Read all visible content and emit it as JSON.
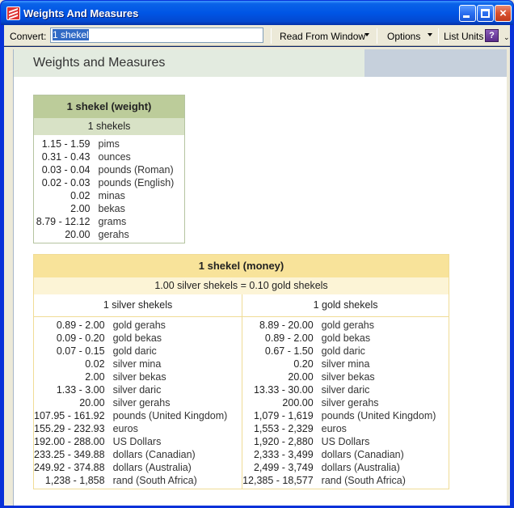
{
  "window": {
    "title": "Weights And Measures"
  },
  "toolbar": {
    "convert_label": "Convert:",
    "convert_value": "1 shekel",
    "read_from_window": "Read From Window",
    "options": "Options",
    "list_units": "List Units",
    "help_glyph": "?"
  },
  "page": {
    "title": "Weights and Measures"
  },
  "weight": {
    "heading": "1 shekel (weight)",
    "subheading": "1 shekels",
    "rows": [
      {
        "value": "1.15 - 1.59",
        "unit": "pims"
      },
      {
        "value": "0.31 - 0.43",
        "unit": "ounces"
      },
      {
        "value": "0.03 - 0.04",
        "unit": "pounds (Roman)"
      },
      {
        "value": "0.02 - 0.03",
        "unit": "pounds (English)"
      },
      {
        "value": "0.02",
        "unit": "minas"
      },
      {
        "value": "2.00",
        "unit": "bekas"
      },
      {
        "value": "8.79 - 12.12",
        "unit": "grams"
      },
      {
        "value": "20.00",
        "unit": "gerahs"
      }
    ]
  },
  "money": {
    "heading": "1 shekel (money)",
    "subheading": "1.00 silver shekels = 0.10 gold shekels",
    "left_header": "1 silver shekels",
    "right_header": "1 gold shekels",
    "rows": [
      {
        "l_value": "0.89 - 2.00",
        "l_unit": "gold gerahs",
        "r_value": "8.89 - 20.00",
        "r_unit": "gold gerahs"
      },
      {
        "l_value": "0.09 - 0.20",
        "l_unit": "gold bekas",
        "r_value": "0.89 - 2.00",
        "r_unit": "gold bekas"
      },
      {
        "l_value": "0.07 - 0.15",
        "l_unit": "gold daric",
        "r_value": "0.67 - 1.50",
        "r_unit": "gold daric"
      },
      {
        "l_value": "0.02",
        "l_unit": "silver mina",
        "r_value": "0.20",
        "r_unit": "silver mina"
      },
      {
        "l_value": "2.00",
        "l_unit": "silver bekas",
        "r_value": "20.00",
        "r_unit": "silver bekas"
      },
      {
        "l_value": "1.33 - 3.00",
        "l_unit": "silver daric",
        "r_value": "13.33 - 30.00",
        "r_unit": "silver daric"
      },
      {
        "l_value": "20.00",
        "l_unit": "silver gerahs",
        "r_value": "200.00",
        "r_unit": "silver gerahs"
      },
      {
        "l_value": "107.95 - 161.92",
        "l_unit": "pounds (United Kingdom)",
        "r_value": "1,079 - 1,619",
        "r_unit": "pounds (United Kingdom)"
      },
      {
        "l_value": "155.29 - 232.93",
        "l_unit": "euros",
        "r_value": "1,553 - 2,329",
        "r_unit": "euros"
      },
      {
        "l_value": "192.00 - 288.00",
        "l_unit": "US Dollars",
        "r_value": "1,920 - 2,880",
        "r_unit": "US Dollars"
      },
      {
        "l_value": "233.25 - 349.88",
        "l_unit": "dollars (Canadian)",
        "r_value": "2,333 - 3,499",
        "r_unit": "dollars (Canadian)"
      },
      {
        "l_value": "249.92 - 374.88",
        "l_unit": "dollars (Australia)",
        "r_value": "2,499 - 3,749",
        "r_unit": "dollars (Australia)"
      },
      {
        "l_value": "1,238 - 1,858",
        "l_unit": "rand (South Africa)",
        "r_value": "12,385 - 18,577",
        "r_unit": "rand (South Africa)"
      }
    ]
  }
}
